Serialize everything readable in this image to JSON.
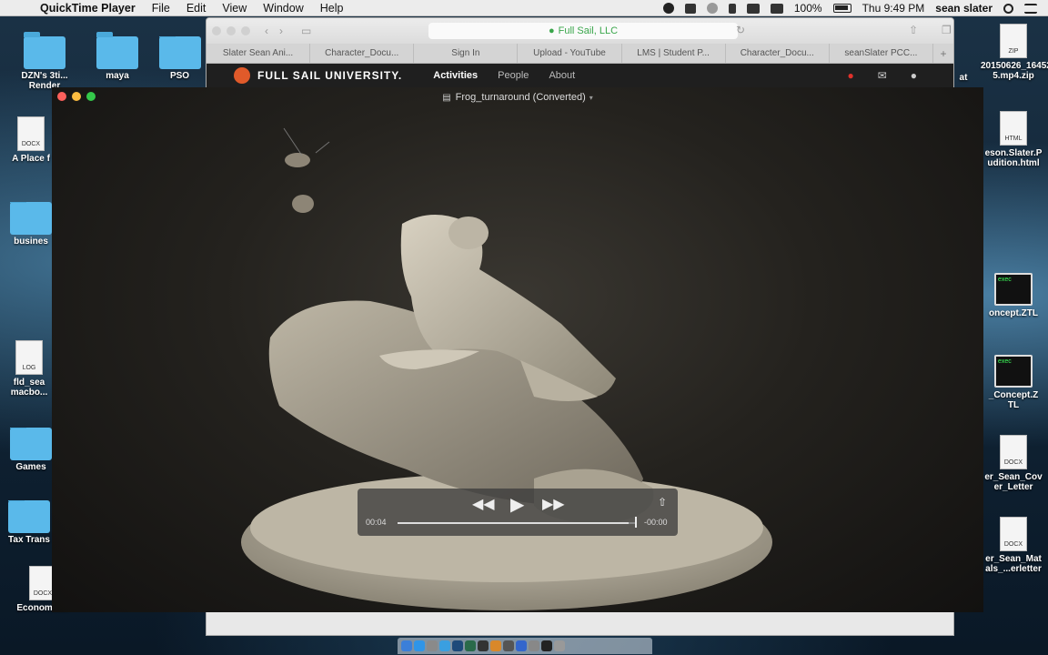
{
  "menubar": {
    "app_name": "QuickTime Player",
    "menus": [
      "File",
      "Edit",
      "View",
      "Window",
      "Help"
    ],
    "battery": "100%",
    "clock": "Thu 9:49 PM",
    "user": "sean slater"
  },
  "desktop_left": [
    {
      "label": "DZN's 3ti...\nRender"
    },
    {
      "label": "maya"
    },
    {
      "label": "PSO"
    },
    {
      "label": "A Place f",
      "badge": "DOCX"
    },
    {
      "label": "busines"
    },
    {
      "label": "fld_sea\nmacbo...",
      "badge": "LOG"
    },
    {
      "label": "Games"
    },
    {
      "label": "Tax Trans"
    },
    {
      "label": "Economous",
      "badge": "DOCX"
    }
  ],
  "desktop_right": [
    {
      "label": "20150626_16452\n5.mp4.zip",
      "badge": "ZIP"
    },
    {
      "label": "eson.Slater.P\nudition.html",
      "badge": "HTML"
    },
    {
      "label": "oncept.ZTL",
      "badge": "exec"
    },
    {
      "label": "_Concept.Z\nTL",
      "badge": "exec"
    },
    {
      "label": "er_Sean_Cov\ner_Letter",
      "badge": "DOCX"
    },
    {
      "label": "er_Sean_Mat\nals_...erletter",
      "badge": "DOCX"
    }
  ],
  "desktop_misc": {
    "at_label": "at"
  },
  "safari": {
    "url": "Full Sail, LLC",
    "tabs": [
      "Slater Sean Ani...",
      "Character_Docu...",
      "Sign In",
      "Upload - YouTube",
      "LMS | Student P...",
      "Character_Docu...",
      "seanSlater PCC..."
    ],
    "site_logo": "FULL SAIL UNIVERSITY.",
    "site_nav": [
      "Activities",
      "People",
      "About"
    ]
  },
  "quicktime": {
    "title": "Frog_turnaround (Converted)",
    "time_elapsed": "00:04",
    "time_remaining": "-00:00",
    "progress": 0.97
  },
  "colors": {
    "accent_orange": "#e05a2a",
    "url_green": "#3aa64b",
    "notify_red": "#e0312b"
  }
}
